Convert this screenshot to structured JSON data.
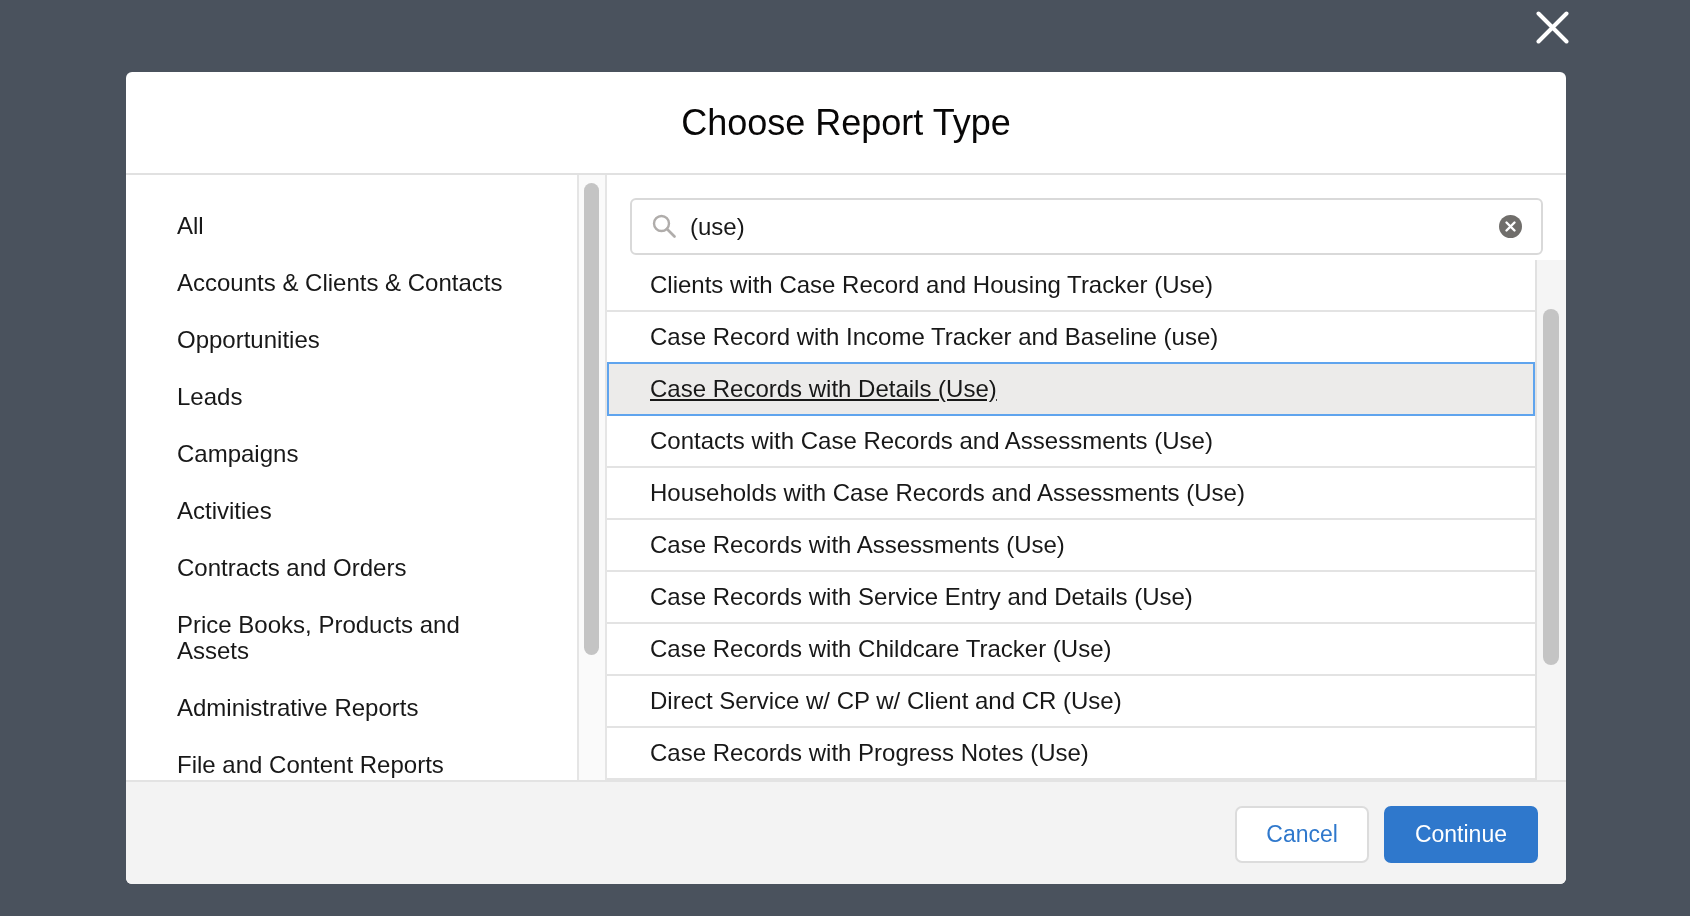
{
  "dialog": {
    "title": "Choose Report Type"
  },
  "categories": [
    {
      "label": "All"
    },
    {
      "label": "Accounts & Clients & Contacts"
    },
    {
      "label": "Opportunities"
    },
    {
      "label": "Leads"
    },
    {
      "label": "Campaigns"
    },
    {
      "label": "Activities"
    },
    {
      "label": "Contracts and Orders"
    },
    {
      "label": "Price Books, Products and Assets"
    },
    {
      "label": "Administrative Reports"
    },
    {
      "label": "File and Content Reports"
    }
  ],
  "search": {
    "value": "(use)"
  },
  "report_types": [
    {
      "label": "Clients with Case Record and Housing Tracker (Use)",
      "selected": false
    },
    {
      "label": "Case Record with Income Tracker and Baseline (use)",
      "selected": false
    },
    {
      "label": "Case Records with Details (Use)",
      "selected": true
    },
    {
      "label": "Contacts with Case Records and Assessments (Use)",
      "selected": false
    },
    {
      "label": "Households with Case Records and Assessments (Use)",
      "selected": false
    },
    {
      "label": "Case Records with Assessments (Use)",
      "selected": false
    },
    {
      "label": "Case Records with Service Entry and Details (Use)",
      "selected": false
    },
    {
      "label": "Case Records with Childcare Tracker (Use)",
      "selected": false
    },
    {
      "label": "Direct Service w/ CP w/ Client and CR (Use)",
      "selected": false
    },
    {
      "label": "Case Records with Progress Notes (Use)",
      "selected": false
    }
  ],
  "buttons": [
    {
      "label": "Cancel",
      "kind": "neutral"
    },
    {
      "label": "Continue",
      "kind": "brand"
    }
  ]
}
